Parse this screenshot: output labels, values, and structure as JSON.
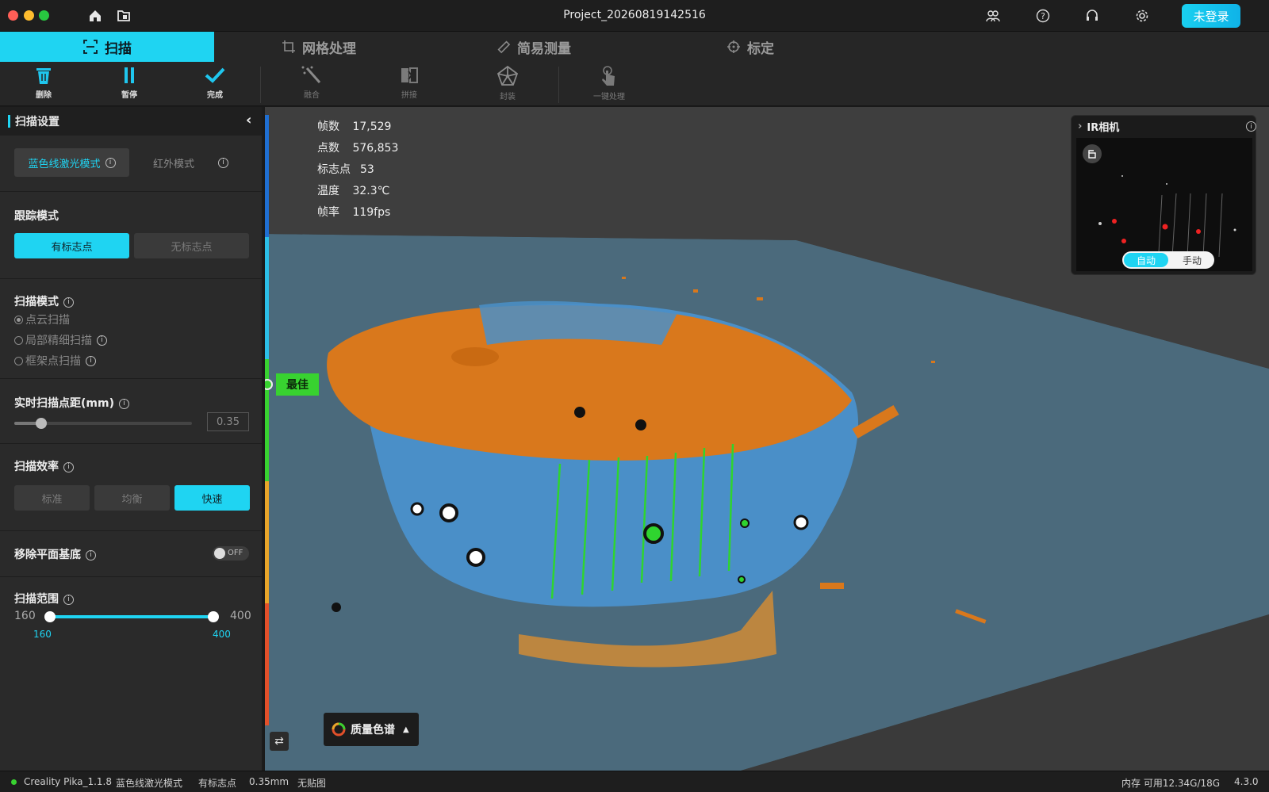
{
  "window": {
    "title": "Project_20260819142516",
    "login_label": "未登录"
  },
  "tabs": [
    {
      "label": "扫描",
      "icon": "scan-frame-icon",
      "active": true
    },
    {
      "label": "网格处理",
      "icon": "crop-icon",
      "active": false
    },
    {
      "label": "简易测量",
      "icon": "ruler-icon",
      "active": false
    },
    {
      "label": "标定",
      "icon": "crosshair-icon",
      "active": false
    }
  ],
  "toolbar": {
    "delete": "删除",
    "pause": "暂停",
    "finish": "完成",
    "fuse": "融合",
    "stitch": "拼接",
    "encapsulate": "封装",
    "one_click": "一键处理"
  },
  "panel": {
    "title": "扫描设置",
    "light_modes": {
      "blue": "蓝色线激光模式",
      "ir": "红外模式"
    },
    "tracking": {
      "title": "跟踪模式",
      "with_markers": "有标志点",
      "without_markers": "无标志点"
    },
    "scan_mode": {
      "title": "扫描模式",
      "options": [
        "点云扫描",
        "局部精细扫描",
        "框架点扫描"
      ],
      "selected": "点云扫描"
    },
    "point_distance": {
      "title": "实时扫描点距(mm)",
      "value": "0.35",
      "level": 0.15
    },
    "efficiency": {
      "title": "扫描效率",
      "options": [
        "标准",
        "均衡",
        "快速"
      ],
      "selected": "快速"
    },
    "remove_base": {
      "title": "移除平面基底",
      "state": "OFF"
    },
    "range": {
      "title": "扫描范围",
      "min": "160",
      "max": "400",
      "low": "160",
      "high": "400"
    }
  },
  "viewport": {
    "stats": [
      {
        "key": "帧数",
        "value": "17,529"
      },
      {
        "key": "点数",
        "value": "576,853"
      },
      {
        "key": "标志点",
        "value": "53"
      },
      {
        "key": "温度",
        "value": "32.3℃"
      },
      {
        "key": "帧率",
        "value": "119fps"
      }
    ],
    "best_label": "最佳",
    "legend_label": "质量色谱",
    "ir_camera": {
      "title": "IR相机",
      "auto": "自动",
      "manual": "手动"
    }
  },
  "statusbar": {
    "app": "Creality Pika_1.1.8",
    "mode": "蓝色线激光模式",
    "tracking": "有标志点",
    "distance": "0.35mm",
    "texture": "无贴图",
    "memory": "内存 可用12.34G/18G",
    "version": "4.3.0"
  },
  "colors": {
    "accent": "#1fd4f2",
    "best": "#38d230",
    "mesh_blue": "#4a8fc8",
    "mesh_orange": "#d9781c"
  }
}
